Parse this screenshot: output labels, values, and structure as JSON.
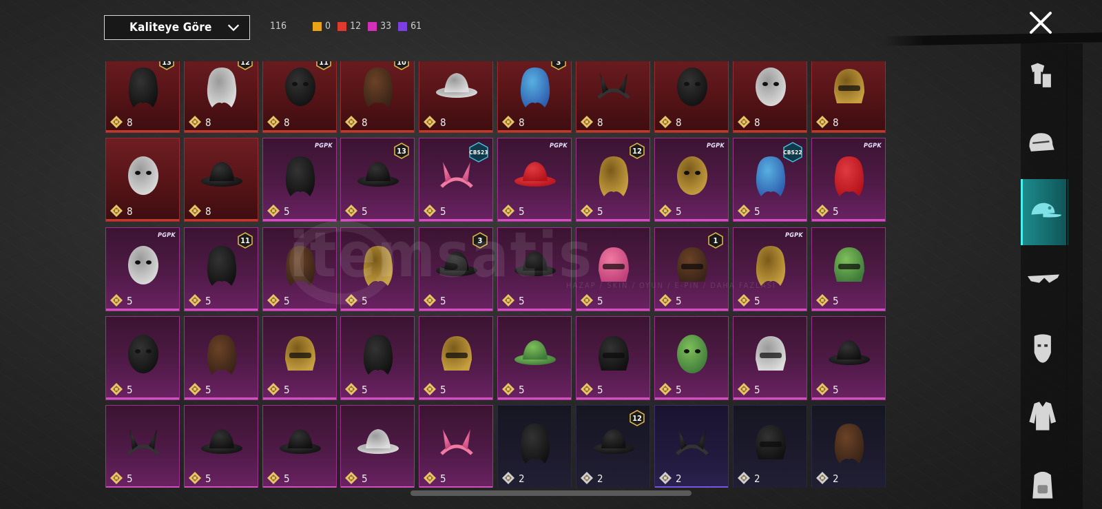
{
  "header": {
    "sort_label": "Kaliteye Göre",
    "total": "116",
    "stats": [
      {
        "color": "#e8a317",
        "value": "0"
      },
      {
        "color": "#e03a2e",
        "value": "12"
      },
      {
        "color": "#d32fb8",
        "value": "33"
      },
      {
        "color": "#7b3fe4",
        "value": "61"
      }
    ]
  },
  "watermark": {
    "text": "itemsatis",
    "sub": "HAZAP / SKIN / OYUN / E-PIN / DAHA FAZLASI"
  },
  "grid": {
    "rows": [
      [
        {
          "rarity": "red",
          "count": "8",
          "badge": "13",
          "icon": "flower-hat-hair-icon"
        },
        {
          "rarity": "red",
          "count": "8",
          "badge": "12",
          "icon": "bunny-ear-white-hair-icon"
        },
        {
          "rarity": "red",
          "count": "8",
          "badge": "11",
          "icon": "black-mask-helmet-icon"
        },
        {
          "rarity": "red",
          "count": "8",
          "badge": "10",
          "icon": "long-brown-hair-icon"
        },
        {
          "rarity": "red",
          "count": "8",
          "badge": "",
          "icon": "white-cowboy-hat-icon"
        },
        {
          "rarity": "red",
          "count": "8",
          "badge": "3",
          "icon": "joker-blue-hair-icon"
        },
        {
          "rarity": "red",
          "count": "8",
          "badge": "",
          "icon": "horned-black-helmet-icon"
        },
        {
          "rarity": "red",
          "count": "8",
          "badge": "",
          "icon": "black-hood-mask-icon"
        },
        {
          "rarity": "red",
          "count": "8",
          "badge": "",
          "icon": "ghost-sheet-icon"
        },
        {
          "rarity": "red",
          "count": "8",
          "badge": "",
          "icon": "pharaoh-helmet-icon"
        }
      ],
      [
        {
          "rarity": "red",
          "count": "8",
          "badge": "",
          "icon": "white-balaclava-icon"
        },
        {
          "rarity": "red",
          "count": "8",
          "badge": "",
          "icon": "tricorne-hat-icon"
        },
        {
          "rarity": "pink",
          "count": "5",
          "tag": "PGPK",
          "icon": "black-tied-hair-icon"
        },
        {
          "rarity": "pink",
          "count": "5",
          "badge": "13",
          "icon": "aviator-cap-goggles-icon"
        },
        {
          "rarity": "pink",
          "count": "5",
          "tag": "CBS23",
          "icon": "cat-ear-headset-icon"
        },
        {
          "rarity": "pink",
          "count": "5",
          "tag": "PGPK",
          "icon": "cap-red-visor-icon"
        },
        {
          "rarity": "pink",
          "count": "5",
          "badge": "12",
          "icon": "orange-pigtail-hair-icon"
        },
        {
          "rarity": "pink",
          "count": "5",
          "tag": "PGPK",
          "icon": "cow-mask-icon"
        },
        {
          "rarity": "pink",
          "count": "5",
          "tag": "CBS22",
          "icon": "purple-blue-hair-icon"
        },
        {
          "rarity": "pink",
          "count": "5",
          "tag": "PGPK",
          "icon": "red-hair-icon"
        }
      ],
      [
        {
          "rarity": "pink",
          "count": "5",
          "tag": "PGPK",
          "icon": "panda-mask-icon"
        },
        {
          "rarity": "pink",
          "count": "5",
          "badge": "11",
          "icon": "flower-headband-hair-icon"
        },
        {
          "rarity": "pink",
          "count": "5",
          "badge": "",
          "icon": "brown-bun-hair-icon"
        },
        {
          "rarity": "pink",
          "count": "5",
          "badge": "",
          "icon": "blonde-curly-hair-icon"
        },
        {
          "rarity": "pink",
          "count": "5",
          "badge": "3",
          "icon": "jester-hat-icon"
        },
        {
          "rarity": "pink",
          "count": "5",
          "badge": "",
          "icon": "wide-brim-hat-icon"
        },
        {
          "rarity": "pink",
          "count": "5",
          "badge": "",
          "icon": "pink-mohawk-helmet-icon"
        },
        {
          "rarity": "pink",
          "count": "5",
          "badge": "1",
          "icon": "feather-headdress-icon"
        },
        {
          "rarity": "pink",
          "count": "5",
          "tag": "PGPK",
          "icon": "blonde-hair-icon"
        },
        {
          "rarity": "pink",
          "count": "5",
          "badge": "",
          "icon": "green-helmet-icon"
        }
      ],
      [
        {
          "rarity": "pink",
          "count": "5",
          "badge": "",
          "icon": "kendo-mask-icon"
        },
        {
          "rarity": "pink",
          "count": "5",
          "badge": "",
          "icon": "ponytail-ribbon-icon"
        },
        {
          "rarity": "pink",
          "count": "5",
          "badge": "",
          "icon": "turban-icon"
        },
        {
          "rarity": "pink",
          "count": "5",
          "badge": "",
          "icon": "witch-hat-hair-icon"
        },
        {
          "rarity": "pink",
          "count": "5",
          "badge": "",
          "icon": "camel-hood-icon"
        },
        {
          "rarity": "pink",
          "count": "5",
          "badge": "",
          "icon": "frog-hat-icon"
        },
        {
          "rarity": "pink",
          "count": "5",
          "badge": "",
          "icon": "cyber-helmet-icon"
        },
        {
          "rarity": "pink",
          "count": "5",
          "badge": "",
          "icon": "frankenstein-mask-icon"
        },
        {
          "rarity": "pink",
          "count": "5",
          "badge": "",
          "icon": "beanie-icon"
        },
        {
          "rarity": "pink",
          "count": "5",
          "badge": "",
          "icon": "officer-cap-icon"
        }
      ],
      [
        {
          "rarity": "pink",
          "count": "5",
          "badge": "",
          "icon": "headband-icon"
        },
        {
          "rarity": "pink",
          "count": "5",
          "badge": "",
          "icon": "top-hat-icon"
        },
        {
          "rarity": "pink",
          "count": "5",
          "badge": "",
          "icon": "witch-hat-icon"
        },
        {
          "rarity": "pink",
          "count": "5",
          "badge": "",
          "icon": "sun-hat-icon"
        },
        {
          "rarity": "pink",
          "count": "5",
          "badge": "",
          "icon": "cat-ear-headband-icon"
        },
        {
          "rarity": "dark",
          "count": "2",
          "badge": "",
          "icon": "black-long-hair-icon"
        },
        {
          "rarity": "dark",
          "count": "2",
          "badge": "12",
          "icon": "bunny-ear-cap-icon"
        },
        {
          "rarity": "purple",
          "count": "2",
          "badge": "",
          "icon": "devil-horns-icon"
        },
        {
          "rarity": "dark",
          "count": "2",
          "badge": "",
          "icon": "motorcycle-helmet-icon"
        },
        {
          "rarity": "dark",
          "count": "2",
          "badge": "",
          "icon": "goggles-hair-icon"
        }
      ]
    ]
  },
  "categories": [
    {
      "icon": "outfit-icon",
      "active": false
    },
    {
      "icon": "helmet-icon",
      "active": false
    },
    {
      "icon": "cap-icon",
      "active": true
    },
    {
      "icon": "sunglasses-icon",
      "active": false
    },
    {
      "icon": "face-mask-icon",
      "active": false
    },
    {
      "icon": "jacket-icon",
      "active": false
    },
    {
      "icon": "backpack-icon",
      "active": false
    }
  ]
}
